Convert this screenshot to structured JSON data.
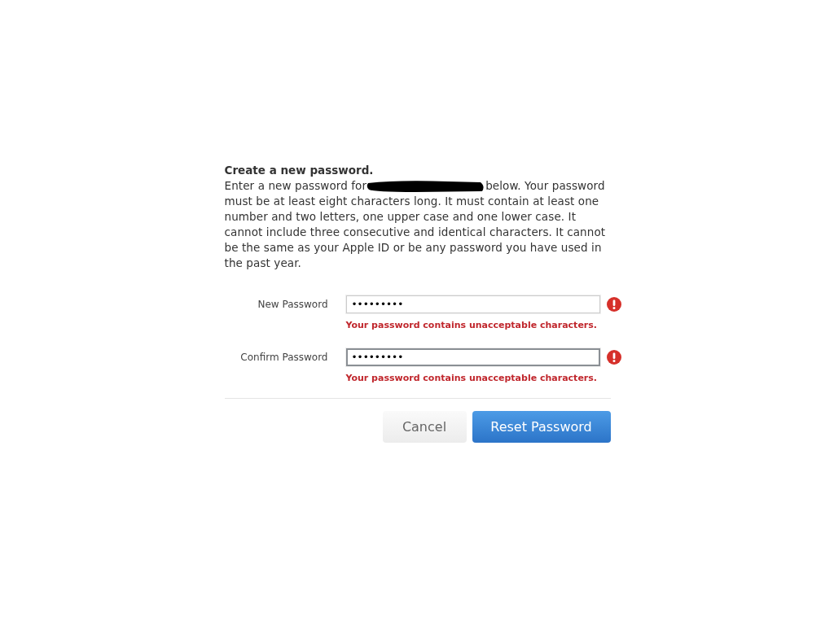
{
  "heading": "Create a new password.",
  "intro_before": "Enter a new password for",
  "intro_after": "below. Your password",
  "intro_rest": "must be at least eight characters long. It must contain at least one number and two letters, one upper case and one lower case. It cannot include three consecutive and identical characters. It cannot be the same as your Apple ID or be any password you have used in the past year.",
  "fields": [
    {
      "label": "New Password",
      "value": "•••••••••",
      "focused": false,
      "error": "Your password contains unacceptable characters."
    },
    {
      "label": "Confirm Password",
      "value": "•••••••••",
      "focused": true,
      "error": "Your password contains unacceptable characters."
    }
  ],
  "buttons": [
    {
      "label": "Cancel",
      "kind": "secondary"
    },
    {
      "label": "Reset Password",
      "kind": "primary"
    }
  ]
}
